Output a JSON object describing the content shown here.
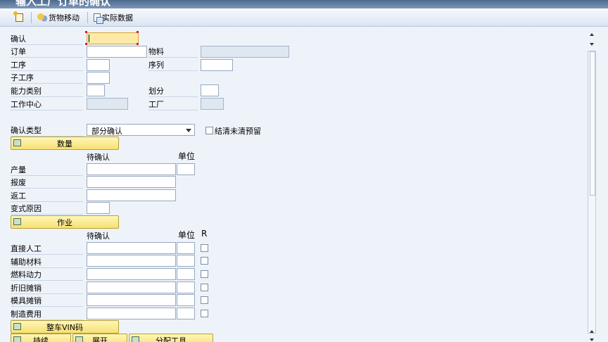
{
  "title": "输入工厂订单的确认",
  "toolbar": {
    "new_icon": "new-document-icon",
    "goods_movement": "货物移动",
    "actual_data": "实际数据"
  },
  "fields": {
    "confirmation": "确认",
    "order": "订单",
    "material": "物料",
    "operation": "工序",
    "sequence": "序列",
    "sub_operation": "子工序",
    "capacity_category": "能力类别",
    "split": "划分",
    "work_center": "工作中心",
    "plant": "工厂"
  },
  "confirmation_type": {
    "label": "确认类型",
    "value": "部分确认",
    "clear_reservations": "结清未清预留"
  },
  "quantity_section": {
    "title": "数量",
    "col_to_confirm": "待确认",
    "col_unit": "单位",
    "rows": [
      "产量",
      "报废",
      "返工",
      "变式原因"
    ]
  },
  "activity_section": {
    "title": "作业",
    "col_to_confirm": "待确认",
    "col_unit": "单位",
    "col_r": "R",
    "rows": [
      "直接人工",
      "辅助材料",
      "燃料动力",
      "折旧摊销",
      "模具摊销",
      "制造费用"
    ]
  },
  "vin_section": {
    "title": "整车VIN码"
  },
  "bottom_buttons": [
    "持续",
    "展开",
    "分配工具"
  ]
}
